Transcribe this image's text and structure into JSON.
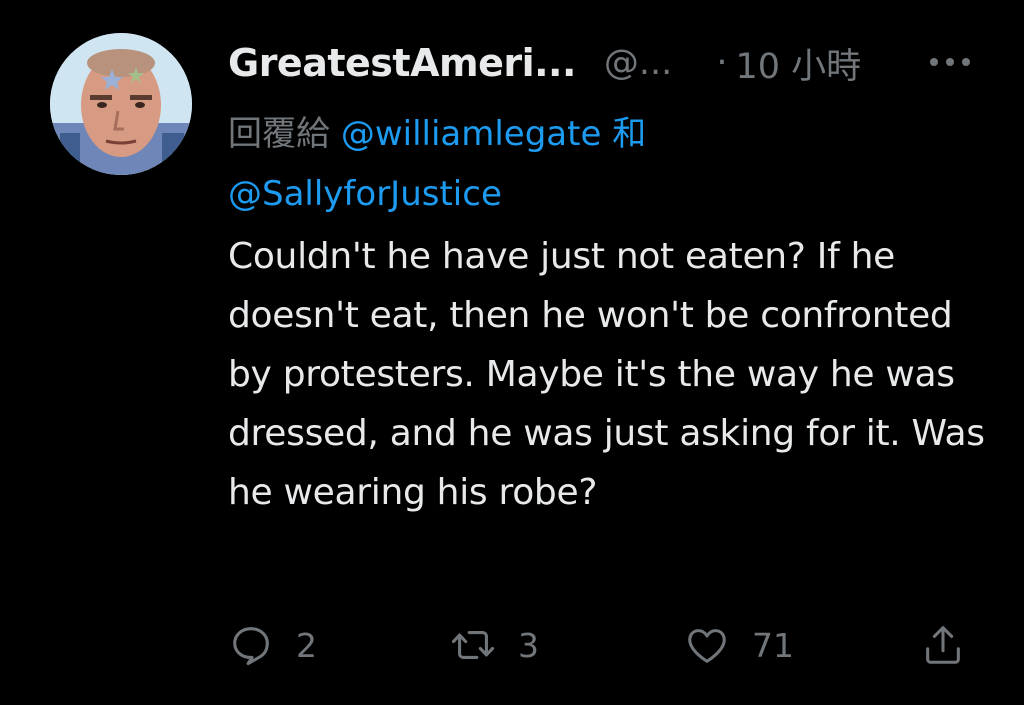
{
  "tweet": {
    "author_name": "GreatestAmeri...",
    "author_handle": "@...",
    "time_separator": "·",
    "time": "10 小時",
    "reply_prefix": "回覆給",
    "reply_mention_1": "@williamlegate",
    "reply_conjunction": "和",
    "reply_mention_2": "@SallyforJustice",
    "text": "Couldn't he have just not eaten? If he doesn't eat, then he won't be confronted by protesters. Maybe it's the way he was dressed, and he was just asking for it. Was he wearing his robe?"
  },
  "actions": {
    "reply_count": "2",
    "retweet_count": "3",
    "like_count": "71"
  },
  "icons": {
    "more": "more-horizontal-icon",
    "reply": "reply-bubble-icon",
    "retweet": "retweet-icon",
    "like": "heart-icon",
    "share": "share-icon"
  },
  "colors": {
    "background": "#000000",
    "text": "#e7e9ea",
    "secondary": "#71767b",
    "mention": "#1d9bf0"
  }
}
